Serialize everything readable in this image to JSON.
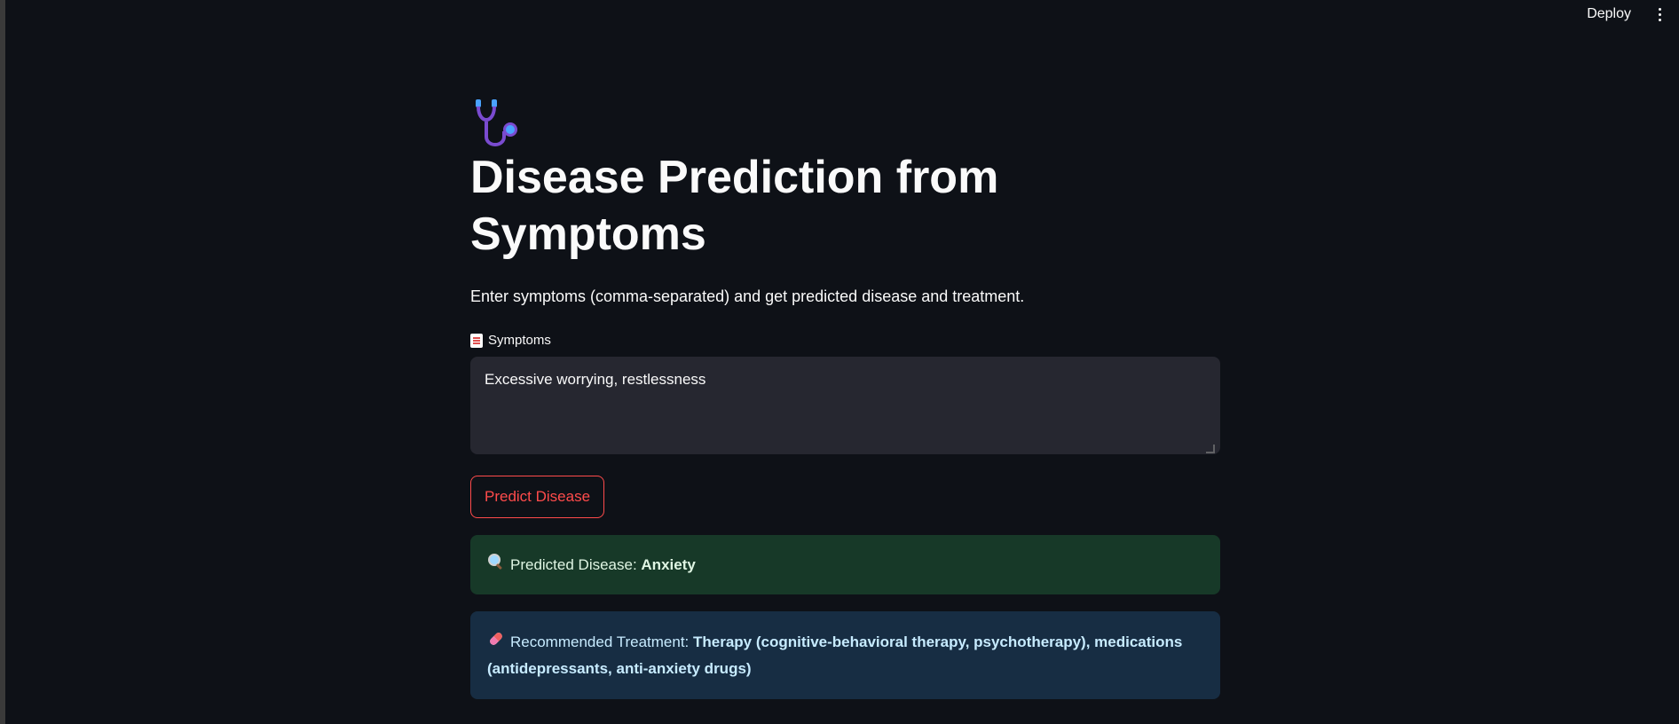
{
  "topbar": {
    "deploy_label": "Deploy",
    "menu_icon": "kebab-menu-icon"
  },
  "header": {
    "icon": "stethoscope-icon",
    "title": "Disease Prediction from Symptoms",
    "subtitle": "Enter symptoms (comma-separated) and get predicted disease and treatment."
  },
  "symptoms_field": {
    "icon": "memo-icon",
    "label": "Symptoms",
    "value": "Excessive worrying, restlessness"
  },
  "predict_button": {
    "label": "Predict Disease",
    "color": "#ff4b4b"
  },
  "prediction": {
    "icon": "magnifier-icon",
    "prefix": "Predicted Disease: ",
    "disease": "Anxiety"
  },
  "treatment": {
    "icon": "pill-icon",
    "prefix": "Recommended Treatment: ",
    "text": "Therapy (cognitive-behavioral therapy, psychotherapy), medications (antidepressants, anti-anxiety drugs)"
  },
  "colors": {
    "background": "#0e1117",
    "success_bg": "#173928",
    "info_bg": "#172d43",
    "accent": "#ff4b4b"
  }
}
